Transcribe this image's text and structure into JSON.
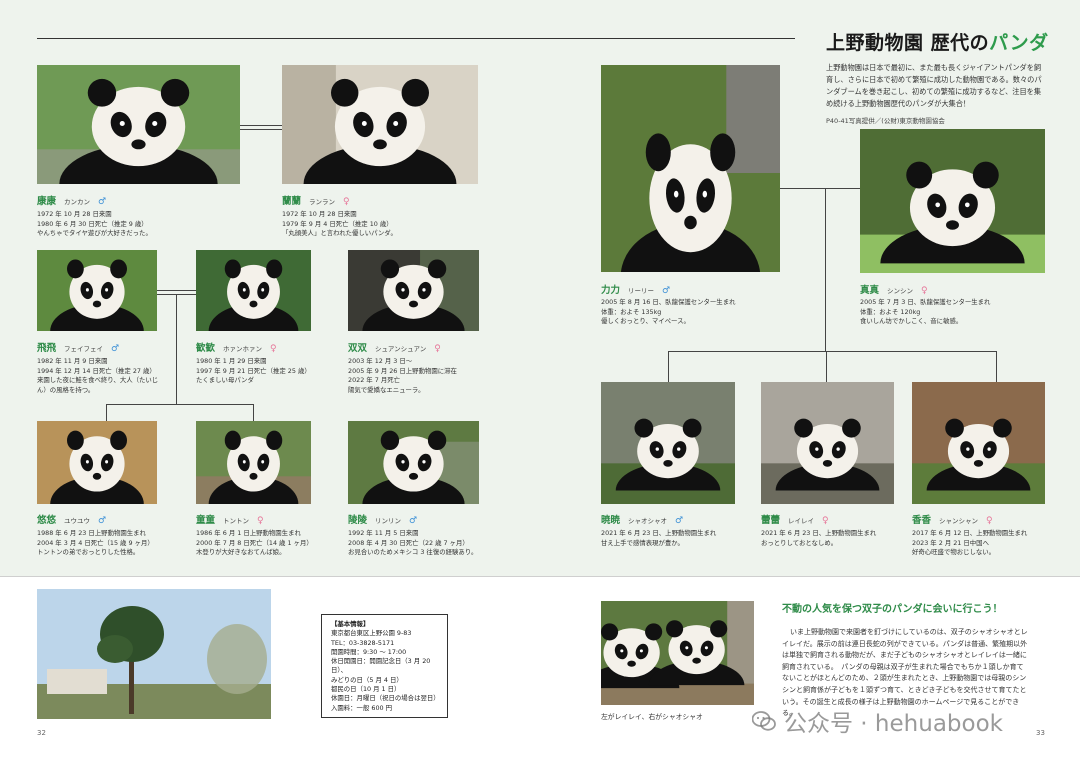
{
  "title": {
    "prefix": "上野動物園 歴代の",
    "highlight": "パンダ"
  },
  "intro": "上野動物園は日本で最初に、また最も長くジャイアントパンダを飼育し、さらに日本で初めて繁殖に成功した動物園である。数々のパンダブームを巻き起こし、初めての繁殖に成功するなど、注目を集め続ける上野動物園歴代のパンダが大集合！",
  "credit": "P40-41写真提供／(公財)東京動物園協会",
  "pandas": {
    "kangkang": {
      "name": "康康",
      "kana": "カンカン",
      "sex": "♂",
      "info": [
        "1972 年 10 月 28 日来園",
        "1980 年 6 月 30 日死亡（推定 9 歳）",
        "やんちゃでタイヤ遊びが大好きだった。"
      ]
    },
    "lanlan": {
      "name": "蘭蘭",
      "kana": "ランラン",
      "sex": "♀",
      "info": [
        "1972 年 10 月 28 日来園",
        "1979 年 9 月 4 日死亡（推定 10 歳）",
        "「丸顔美人」と言われた優しいパンダ。"
      ]
    },
    "feifei": {
      "name": "飛飛",
      "kana": "フェイフェイ",
      "sex": "♂",
      "info": [
        "1982 年 11 月 9 日来園",
        "1994 年 12 月 14 日死亡（推定 27 歳）",
        "来園した夜に鮭を食べ終り、大人（たいじん）の風格を持つ。"
      ]
    },
    "huanhuan": {
      "name": "歓歓",
      "kana": "ホァンホァン",
      "sex": "♀",
      "info": [
        "1980 年 1 月 29 日来園",
        "1997 年 9 月 21 日死亡（推定 25 歳）",
        "たくましい母パンダ"
      ]
    },
    "shuangshuang": {
      "name": "双双",
      "kana": "シュアンシュアン",
      "sex": "♀",
      "info": [
        "2003 年 12 月 3 日〜",
        "2005 年 9 月 26 日上野動物園に滞在",
        "2022 年 7 月死亡",
        "陽気で愛嬌なエニューラ。"
      ]
    },
    "youyou": {
      "name": "悠悠",
      "kana": "ユウユウ",
      "sex": "♂",
      "info": [
        "1988 年 6 月 23 日上野動物園生まれ",
        "2004 年 3 月 4 日死亡（15 歳 9 ヶ月）",
        "トントンの弟でおっとりした性格。"
      ]
    },
    "tongtong": {
      "name": "童童",
      "kana": "トントン",
      "sex": "♀",
      "info": [
        "1986 年 6 月 1 日上野動物園生まれ",
        "2000 年 7 月 8 日死亡（14 歳 1 ヶ月）",
        "木登りが大好きなおてんば娘。"
      ]
    },
    "lingling": {
      "name": "陵陵",
      "kana": "リンリン",
      "sex": "♂",
      "info": [
        "1992 年 11 月 5 日来園",
        "2008 年 4 月 30 日死亡（22 歳 7 ヶ月）",
        "お見合いのためメキシコ 3 往復の経験あり。"
      ]
    },
    "riri": {
      "name": "力力",
      "kana": "リーリー",
      "sex": "♂",
      "info": [
        "2005 年 8 月 16 日、臥龍保護センター生まれ",
        "体重：およそ 135kg",
        "優しくおっとり、マイペース。"
      ]
    },
    "shinshin": {
      "name": "真真",
      "kana": "シンシン",
      "sex": "♀",
      "info": [
        "2005 年 7 月 3 日、臥龍保護センター生まれ",
        "体重：およそ 120kg",
        "食いしん坊でかしこく、音に敏感。"
      ]
    },
    "xiaoxiao": {
      "name": "暁暁",
      "kana": "シャオシャオ",
      "sex": "♂",
      "info": [
        "2021 年 6 月 23 日、上野動物園生まれ",
        "甘え上手で感情表現が豊か。"
      ]
    },
    "leilei": {
      "name": "蕾蕾",
      "kana": "レイレイ",
      "sex": "♀",
      "info": [
        "2021 年 6 月 23 日、上野動物園生まれ",
        "おっとりしておとなしめ。"
      ]
    },
    "xiangxiang": {
      "name": "香香",
      "kana": "シャンシャン",
      "sex": "♀",
      "info": [
        "2017 年 6 月 12 日、上野動物園生まれ",
        "2023 年 2 月 21 日中国へ",
        "好奇心旺盛で物おじしない。"
      ]
    }
  },
  "basic_info": {
    "heading": "【基本情報】",
    "lines": [
      "東京都台東区上野公園 9-83",
      "TEL：03-3828-5171",
      "開園時間：9:30 〜 17:00",
      "休日開園日：開園記念日（3 月 20 日）、",
      "みどりの日（5 月 4 日）",
      "都民の日（10 月 1 日）",
      "休園日：月曜日（祝日の場合は翌日）",
      "入園料：一般 600 円"
    ]
  },
  "twins": {
    "title": "不動の人気を保つ双子のパンダに会いに行こう！",
    "body": "いま上野動物園で来園者を釘づけにしているのは、双子のシャオシャオとレイレイだ。展示の前は連日長蛇の列ができている。パンダは普通、繁殖期以外は単独で飼育される動物だが、まだ子どものシャオシャオとレイレイは一緒に飼育されている。　パンダの母親は双子が生まれた場合でもちか１頭しか育てないことがほとんどのため、２頭が生まれたとき、上野動物園では母親のシンシンと飼育係が子どもを１頭ずつ育て、ときどき子どもを交代させて育てたという。その誕生と成長の様子は上野動物園のホームページで見ることができる。",
    "caption": "左がレイレイ、右がシャオシャオ"
  },
  "page_numbers": {
    "left": "32",
    "right": "33"
  },
  "watermark": "公众号 · hehuabook",
  "colors": {
    "accent_green": "#2e8b48",
    "male_blue": "#3a8fd6",
    "female_pink": "#e6779a",
    "page_bg": "#eef3ed"
  }
}
